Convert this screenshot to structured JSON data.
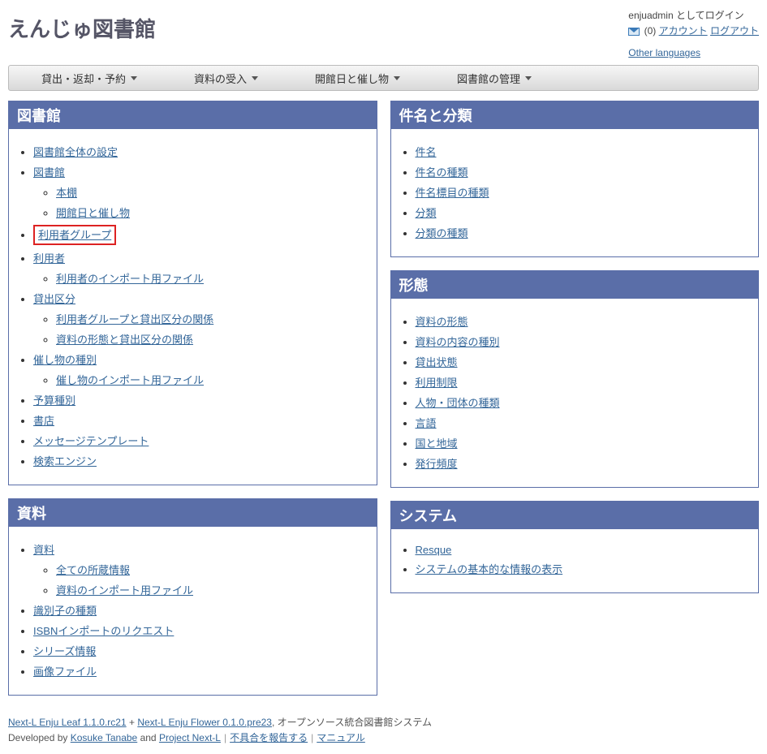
{
  "header": {
    "title": "えんじゅ図書館",
    "logged_in_as_prefix": "enjuadmin",
    "logged_in_as_suffix": " としてログイン",
    "message_count": "(0)",
    "account_link": "アカウント",
    "logout_link": "ログアウト",
    "other_languages": "Other languages"
  },
  "menu": {
    "items": [
      "貸出・返却・予約",
      "資料の受入",
      "開館日と催し物",
      "図書館の管理"
    ]
  },
  "left": {
    "library": {
      "title": "図書館",
      "items": {
        "i0": "図書館全体の設定",
        "i1": "図書館",
        "i1_sub": {
          "s0": "本棚",
          "s1": "開館日と催し物"
        },
        "i2": "利用者グループ",
        "i3": "利用者",
        "i3_sub": {
          "s0": "利用者のインポート用ファイル"
        },
        "i4": "貸出区分",
        "i4_sub": {
          "s0": "利用者グループと貸出区分の関係",
          "s1": "資料の形態と貸出区分の関係"
        },
        "i5": "催し物の種別",
        "i5_sub": {
          "s0": "催し物のインポート用ファイル"
        },
        "i6": "予算種別",
        "i7": "書店",
        "i8": "メッセージテンプレート",
        "i9": "検索エンジン"
      }
    },
    "material": {
      "title": "資料",
      "items": {
        "i0": "資料",
        "i0_sub": {
          "s0": "全ての所蔵情報",
          "s1": "資料のインポート用ファイル"
        },
        "i1": "識別子の種類",
        "i2": "ISBNインポートのリクエスト",
        "i3": "シリーズ情報",
        "i4": "画像ファイル"
      }
    }
  },
  "right": {
    "subject": {
      "title": "件名と分類",
      "items": {
        "i0": "件名",
        "i1": "件名の種類",
        "i2": "件名標目の種類",
        "i3": "分類",
        "i4": "分類の種類"
      }
    },
    "form": {
      "title": "形態",
      "items": {
        "i0": "資料の形態",
        "i1": "資料の内容の種別",
        "i2": "貸出状態",
        "i3": "利用制限",
        "i4": "人物・団体の種類",
        "i5": "言語",
        "i6": "国と地域",
        "i7": "発行頻度"
      }
    },
    "system": {
      "title": "システム",
      "items": {
        "i0": "Resque",
        "i1": "システムの基本的な情報の表示"
      }
    }
  },
  "footer": {
    "leaf": "Next-L Enju Leaf 1.1.0.rc21",
    "plus": " + ",
    "flower": "Next-L Enju Flower 0.1.0.pre23",
    "tagline": ", オープンソース統合図書館システム",
    "dev_by": "Developed by ",
    "dev_name": "Kosuke Tanabe",
    "and": " and ",
    "project": "Project Next-L",
    "bug": "不具合を報告する",
    "manual": "マニュアル"
  }
}
